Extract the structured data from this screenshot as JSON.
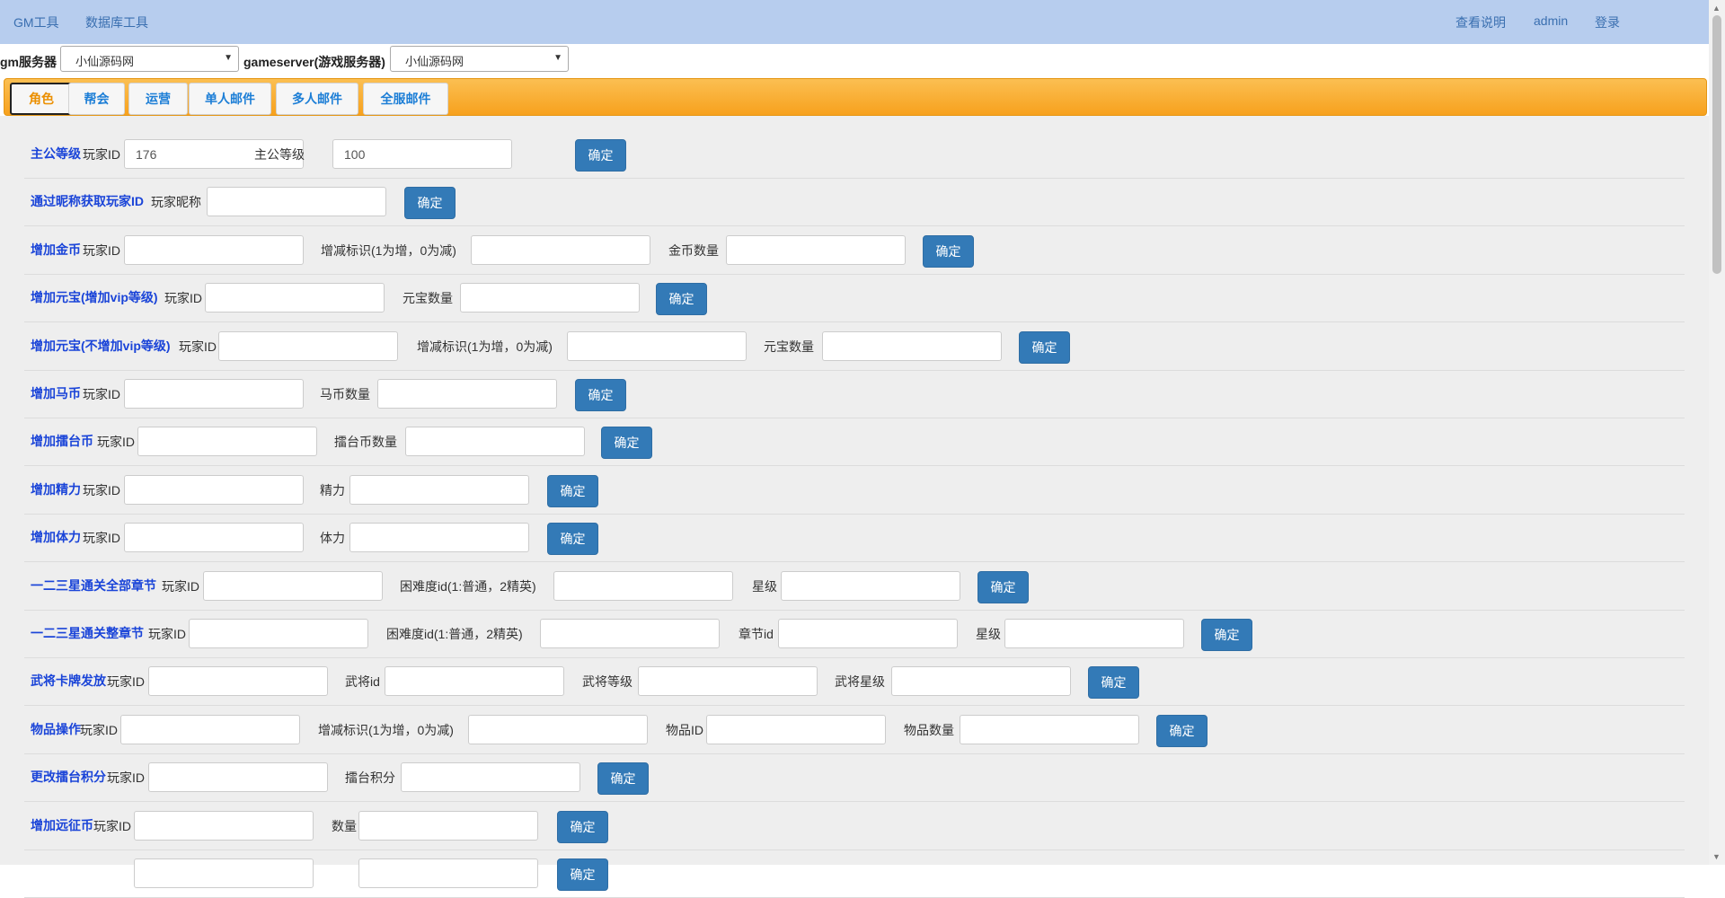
{
  "nav": {
    "left": [
      "GM工具",
      "数据库工具"
    ],
    "right": [
      "查看说明",
      "admin",
      "登录"
    ]
  },
  "servers": {
    "gm_label": "gm服务器",
    "gm_value": "小仙源码网",
    "game_label": "gameserver(游戏服务器)",
    "game_value": "小仙源码网"
  },
  "tabs": [
    {
      "label": "角色",
      "active": true
    },
    {
      "label": "帮会",
      "active": false
    },
    {
      "label": "运营",
      "active": false
    },
    {
      "label": "单人邮件",
      "active": false
    },
    {
      "label": "多人邮件",
      "active": false
    },
    {
      "label": "全服邮件",
      "active": false
    }
  ],
  "confirm_label": "确定",
  "rows": [
    {
      "title": "主公等级",
      "fields": [
        {
          "label": "玩家ID",
          "value": "176"
        },
        {
          "label": "主公等级",
          "value": "100"
        }
      ]
    },
    {
      "title": "通过昵称获取玩家ID",
      "fields": [
        {
          "label": "玩家昵称",
          "value": ""
        }
      ]
    },
    {
      "title": "增加金币",
      "fields": [
        {
          "label": "玩家ID",
          "value": ""
        },
        {
          "label": "增减标识(1为增，0为减)",
          "value": ""
        },
        {
          "label": "金币数量",
          "value": ""
        }
      ]
    },
    {
      "title": "增加元宝(增加vip等级)",
      "fields": [
        {
          "label": "玩家ID",
          "value": ""
        },
        {
          "label": "元宝数量",
          "value": ""
        }
      ]
    },
    {
      "title": "增加元宝(不增加vip等级)",
      "fields": [
        {
          "label": "玩家ID",
          "value": ""
        },
        {
          "label": "增减标识(1为增，0为减)",
          "value": ""
        },
        {
          "label": "元宝数量",
          "value": ""
        }
      ]
    },
    {
      "title": "增加马币",
      "fields": [
        {
          "label": "玩家ID",
          "value": ""
        },
        {
          "label": "马币数量",
          "value": ""
        }
      ]
    },
    {
      "title": "增加擂台币",
      "fields": [
        {
          "label": "玩家ID",
          "value": ""
        },
        {
          "label": "擂台币数量",
          "value": ""
        }
      ]
    },
    {
      "title": "增加精力",
      "fields": [
        {
          "label": "玩家ID",
          "value": ""
        },
        {
          "label": "精力",
          "value": ""
        }
      ]
    },
    {
      "title": "增加体力",
      "fields": [
        {
          "label": "玩家ID",
          "value": ""
        },
        {
          "label": "体力",
          "value": ""
        }
      ]
    },
    {
      "title": "一二三星通关全部章节",
      "fields": [
        {
          "label": "玩家ID",
          "value": ""
        },
        {
          "label": "困难度id(1:普通，2精英)",
          "value": ""
        },
        {
          "label": "星级",
          "value": ""
        }
      ]
    },
    {
      "title": "一二三星通关整章节",
      "fields": [
        {
          "label": "玩家ID",
          "value": ""
        },
        {
          "label": "困难度id(1:普通，2精英)",
          "value": ""
        },
        {
          "label": "章节id",
          "value": ""
        },
        {
          "label": "星级",
          "value": ""
        }
      ]
    },
    {
      "title": "武将卡牌发放",
      "fields": [
        {
          "label": "玩家ID",
          "value": ""
        },
        {
          "label": "武将id",
          "value": ""
        },
        {
          "label": "武将等级",
          "value": ""
        },
        {
          "label": "武将星级",
          "value": ""
        }
      ]
    },
    {
      "title": "物品操作",
      "fields": [
        {
          "label": "玩家ID",
          "value": ""
        },
        {
          "label": "增减标识(1为增，0为减)",
          "value": ""
        },
        {
          "label": "物品ID",
          "value": ""
        },
        {
          "label": "物品数量",
          "value": ""
        }
      ]
    },
    {
      "title": "更改擂台积分",
      "fields": [
        {
          "label": "玩家ID",
          "value": ""
        },
        {
          "label": "擂台积分",
          "value": ""
        }
      ]
    },
    {
      "title": "增加远征币",
      "fields": [
        {
          "label": "玩家ID",
          "value": ""
        },
        {
          "label": "数量",
          "value": ""
        }
      ]
    },
    {
      "title": "",
      "fields": [
        {
          "label": "",
          "value": ""
        },
        {
          "label": "",
          "value": ""
        }
      ]
    }
  ]
}
